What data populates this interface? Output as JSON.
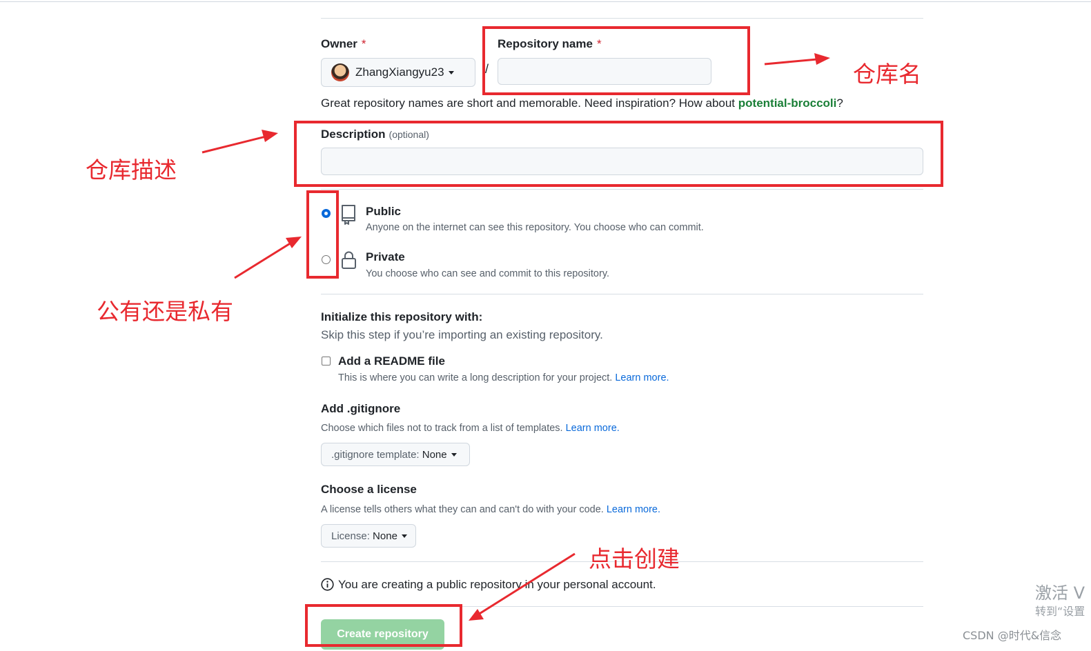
{
  "form": {
    "owner_label": "Owner",
    "required_mark": "*",
    "owner_name": "ZhangXiangyu23",
    "slash": "/",
    "repo_name_label": "Repository name",
    "repo_name_value": "",
    "hint_prefix": "Great repository names are short and memorable. Need inspiration? How about",
    "hint_suggestion": "potential-broccoli",
    "hint_suffix": "?",
    "description_label": "Description",
    "description_optional": "(optional)",
    "description_value": "",
    "visibility": {
      "selected": "public",
      "public_title": "Public",
      "public_desc": "Anyone on the internet can see this repository. You choose who can commit.",
      "private_title": "Private",
      "private_desc": "You choose who can see and commit to this repository."
    },
    "init_title": "Initialize this repository with:",
    "init_subtitle": "Skip this step if you’re importing an existing repository.",
    "readme_label": "Add a README file",
    "readme_checked": false,
    "readme_desc": "This is where you can write a long description for your project.",
    "learn_more": "Learn more.",
    "gitignore_title": "Add .gitignore",
    "gitignore_desc": "Choose which files not to track from a list of templates.",
    "gitignore_btn_prefix": ".gitignore template:",
    "gitignore_btn_value": "None",
    "license_title": "Choose a license",
    "license_desc": "A license tells others what they can and can't do with your code.",
    "license_btn_prefix": "License:",
    "license_btn_value": "None",
    "notice": "You are creating a public repository in your personal account.",
    "create_button": "Create repository"
  },
  "annotations": {
    "repo_name": "仓库名",
    "description": "仓库描述",
    "visibility": "公有还是私有",
    "create": "点击创建",
    "color": "#e8292f"
  },
  "watermark": {
    "activate_line1": "激活 V",
    "activate_line2": "转到“设置",
    "csdn": "CSDN @时代&信念"
  },
  "colors": {
    "accent_link": "#0969da",
    "suggestion_green": "#1a7f37",
    "create_button_bg": "#94d3a2",
    "required_red": "#cf222e"
  }
}
